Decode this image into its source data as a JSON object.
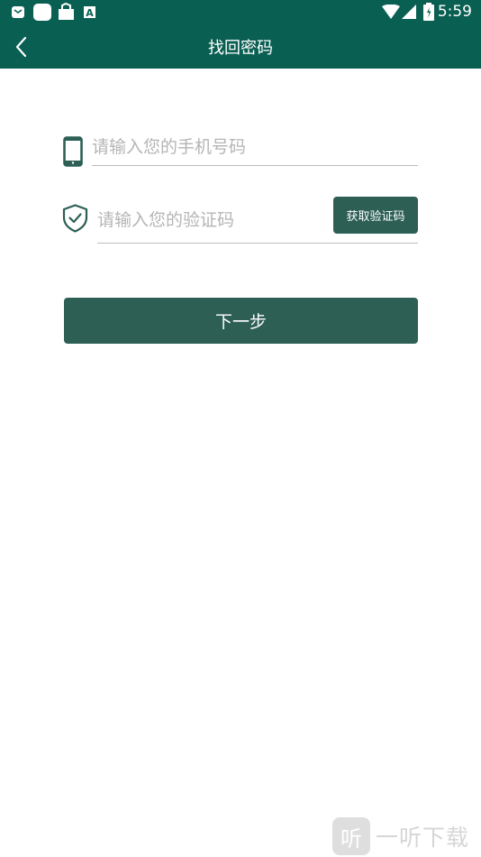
{
  "status_bar": {
    "time": "5:59",
    "left_icons": [
      "mail-notification-icon",
      "app-notification-icon",
      "bag-notification-icon",
      "a-notification-icon"
    ],
    "right_icons": [
      "wifi-icon",
      "signal-icon",
      "battery-icon"
    ]
  },
  "app_bar": {
    "back_icon": "chevron-left-icon",
    "title": "找回密码"
  },
  "form": {
    "phone_placeholder": "请输入您的手机号码",
    "phone_icon": "phone-icon",
    "code_placeholder": "请输入您的验证码",
    "code_icon": "shield-check-icon",
    "get_code_label": "获取验证码",
    "next_label": "下一步"
  },
  "watermark": {
    "logo_char": "听",
    "text": "一听下载"
  },
  "colors": {
    "header_bg": "#0a5f53",
    "button_bg": "#2d5f55",
    "placeholder": "#b5b5b5"
  }
}
